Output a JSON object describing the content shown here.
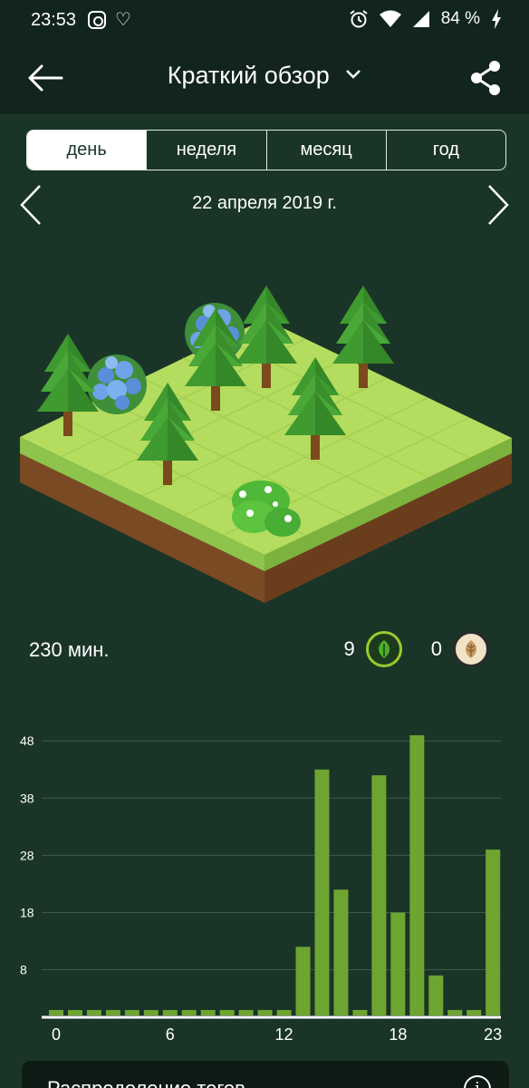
{
  "status": {
    "time": "23:53",
    "battery": "84 %"
  },
  "appbar": {
    "title": "Краткий обзор"
  },
  "tabs": [
    "день",
    "неделя",
    "месяц",
    "год"
  ],
  "active_tab": 0,
  "date": "22 апреля 2019 г.",
  "summary": {
    "minutes": "230 мин.",
    "alive_count": "9",
    "dead_count": "0"
  },
  "colors": {
    "background": "#1a3528",
    "bar": "#6ea531",
    "grid": "#3f5a4c"
  },
  "chart_data": {
    "type": "bar",
    "categories": [
      0,
      1,
      2,
      3,
      4,
      5,
      6,
      7,
      8,
      9,
      10,
      11,
      12,
      13,
      14,
      15,
      16,
      17,
      18,
      19,
      20,
      21,
      22,
      23
    ],
    "values": [
      0,
      0,
      0,
      0,
      0,
      0,
      0,
      0,
      0,
      0,
      0,
      0,
      0,
      12,
      43,
      22,
      0,
      42,
      18,
      49,
      7,
      0,
      0,
      29
    ],
    "yticks": [
      8,
      18,
      28,
      38,
      48
    ],
    "xtick_labels": [
      "0",
      "6",
      "12",
      "18",
      "23"
    ],
    "ylim": [
      0,
      52
    ],
    "grid": true,
    "title": "",
    "xlabel": "",
    "ylabel": ""
  },
  "card": {
    "title": "Распределение тегов"
  }
}
